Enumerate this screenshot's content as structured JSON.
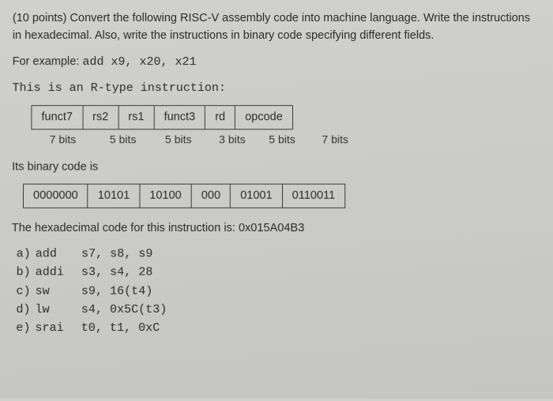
{
  "question": {
    "prompt": "(10 points) Convert the following RISC-V assembly code into machine language. Write the instructions in hexadecimal. Also, write the instructions in binary code specifying different fields.",
    "example_intro": "For example: ",
    "example_instr": "add  x9,  x20,  x21",
    "rtype_line": "This is an R-type instruction:",
    "binary_intro": "Its binary code is",
    "hex_line": "The hexadecimal code for this instruction is: 0x015A04B3"
  },
  "field_headers": [
    "funct7",
    "rs2",
    "rs1",
    "funct3",
    "rd",
    "opcode"
  ],
  "field_bits": [
    "7 bits",
    "5 bits",
    "5 bits",
    "3 bits",
    "5 bits",
    "7 bits"
  ],
  "binary_values": [
    "0000000",
    "10101",
    "10100",
    "000",
    "01001",
    "0110011"
  ],
  "answers": [
    {
      "lbl": "a)",
      "op": "add",
      "args": "s7, s8, s9"
    },
    {
      "lbl": "b)",
      "op": "addi",
      "args": "s3, s4, 28"
    },
    {
      "lbl": "c)",
      "op": "sw",
      "args": "s9, 16(t4)"
    },
    {
      "lbl": "d)",
      "op": "lw",
      "args": "s4, 0x5C(t3)"
    },
    {
      "lbl": "e)",
      "op": "srai",
      "args": "t0, t1, 0xC"
    }
  ],
  "chart_data": {
    "type": "table",
    "title": "R-type instruction fields",
    "columns": [
      "funct7",
      "rs2",
      "rs1",
      "funct3",
      "rd",
      "opcode"
    ],
    "widths": [
      "7 bits",
      "5 bits",
      "5 bits",
      "3 bits",
      "5 bits",
      "7 bits"
    ],
    "example_binary": [
      "0000000",
      "10101",
      "10100",
      "000",
      "01001",
      "0110011"
    ],
    "example_hex": "0x015A04B3"
  }
}
